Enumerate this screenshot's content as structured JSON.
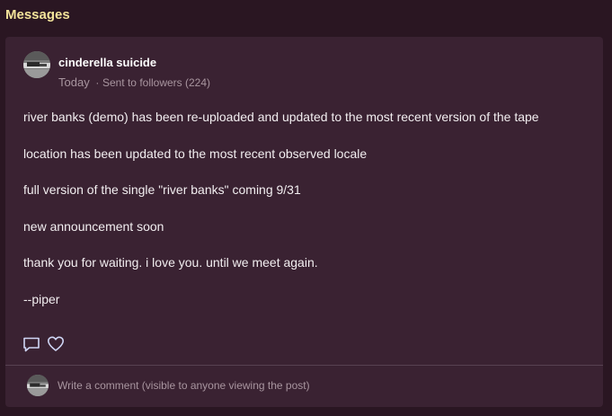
{
  "section": {
    "title": "Messages"
  },
  "post": {
    "author": "cinderella suicide",
    "timestamp": "Today",
    "separator": "·",
    "audience": "Sent to followers (224)",
    "paragraphs": [
      "river banks (demo) has been re-uploaded and updated to the most recent version of the tape",
      "location has been updated to the most recent observed locale",
      "full version of the single \"river banks\" coming 9/31",
      "new announcement soon",
      "thank you for waiting. i love you. until we meet again.",
      "--piper"
    ],
    "actions": {
      "comment_icon": "comment-icon",
      "like_icon": "heart-icon"
    }
  },
  "comment_box": {
    "placeholder": "Write a comment (visible to anyone viewing the post)"
  },
  "colors": {
    "page_background": "#2a1622",
    "card_background": "#3a2232",
    "section_title": "#f3e39a",
    "muted_text": "#a8959f",
    "icon_stroke": "#cfd6f5"
  }
}
